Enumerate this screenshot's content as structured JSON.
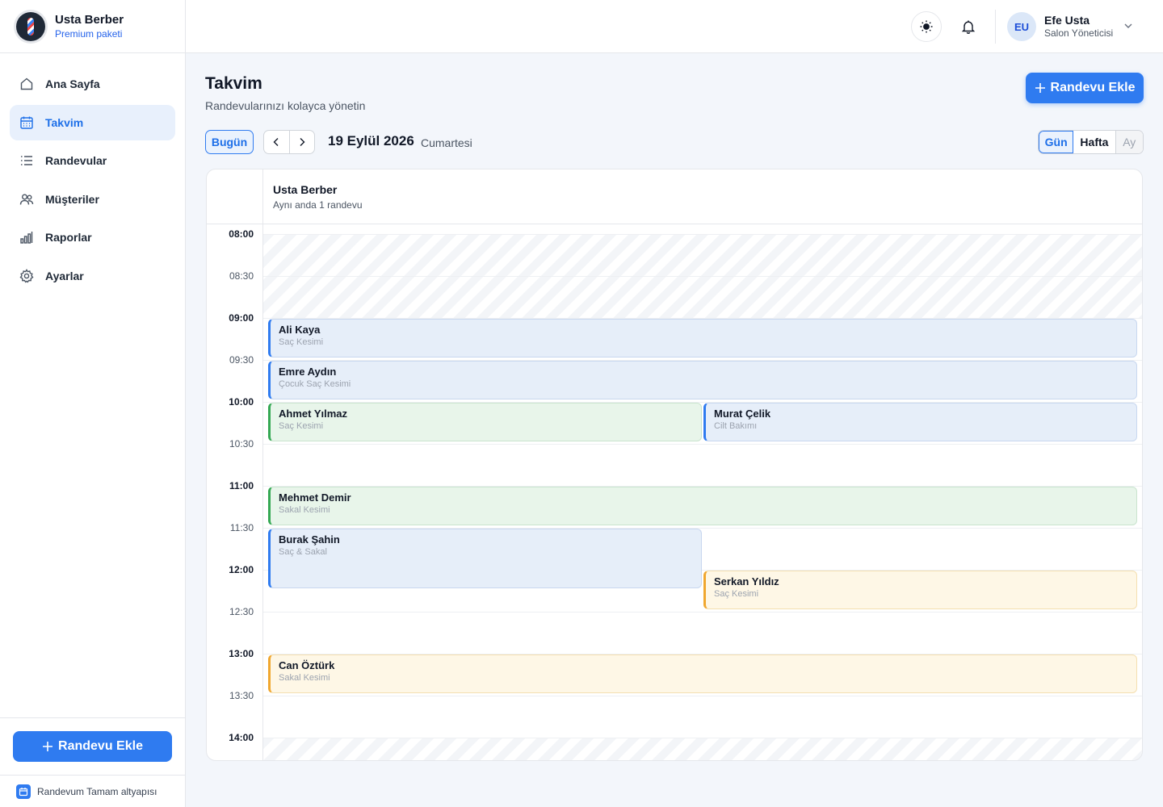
{
  "brand": {
    "name": "Usta Berber",
    "plan": "Premium paketi"
  },
  "sidebar": {
    "items": [
      {
        "label": "Ana Sayfa",
        "icon": "home-icon",
        "active": false
      },
      {
        "label": "Takvim",
        "icon": "calendar-icon",
        "active": true
      },
      {
        "label": "Randevular",
        "icon": "list-icon",
        "active": false
      },
      {
        "label": "Müşteriler",
        "icon": "users-icon",
        "active": false
      },
      {
        "label": "Raporlar",
        "icon": "chart-icon",
        "active": false
      },
      {
        "label": "Ayarlar",
        "icon": "gear-icon",
        "active": false
      }
    ],
    "add_button": "Randevu Ekle",
    "footer": "Randevum Tamam altyapısı"
  },
  "topbar": {
    "user": {
      "initials": "EU",
      "name": "Efe Usta",
      "role": "Salon Yöneticisi"
    }
  },
  "page": {
    "title": "Takvim",
    "subtitle": "Randevularınızı kolayca yönetin",
    "add_button": "Randevu Ekle"
  },
  "toolbar": {
    "today": "Bugün",
    "date": "19 Eylül 2026",
    "weekday": "Cumartesi",
    "views": {
      "day": "Gün",
      "week": "Hafta",
      "month": "Ay"
    },
    "selected_view": "Gün"
  },
  "calendar": {
    "staff": {
      "name": "Usta Berber",
      "capacity": "Aynı anda 1 randevu"
    },
    "slots": [
      "08:00",
      "08:30",
      "09:00",
      "09:30",
      "10:00",
      "10:30",
      "11:00",
      "11:30",
      "12:00",
      "12:30",
      "13:00",
      "13:30",
      "14:00"
    ],
    "appointments": [
      {
        "name": "Ali Kaya",
        "service": "Saç Kesimi",
        "color": "blue"
      },
      {
        "name": "Emre Aydın",
        "service": "Çocuk Saç Kesimi",
        "color": "blue"
      },
      {
        "name": "Ahmet Yılmaz",
        "service": "Saç Kesimi",
        "color": "green"
      },
      {
        "name": "Murat Çelik",
        "service": "Cilt Bakımı",
        "color": "blue"
      },
      {
        "name": "Mehmet Demir",
        "service": "Sakal Kesimi",
        "color": "green"
      },
      {
        "name": "Burak Şahin",
        "service": "Saç & Sakal",
        "color": "blue"
      },
      {
        "name": "Serkan Yıldız",
        "service": "Saç Kesimi",
        "color": "amber"
      },
      {
        "name": "Can Öztürk",
        "service": "Sakal Kesimi",
        "color": "amber"
      }
    ]
  },
  "colors": {
    "accent": "#2f7bf0",
    "blue": "#2f7bf0",
    "green": "#34a853",
    "amber": "#f0a72f"
  }
}
